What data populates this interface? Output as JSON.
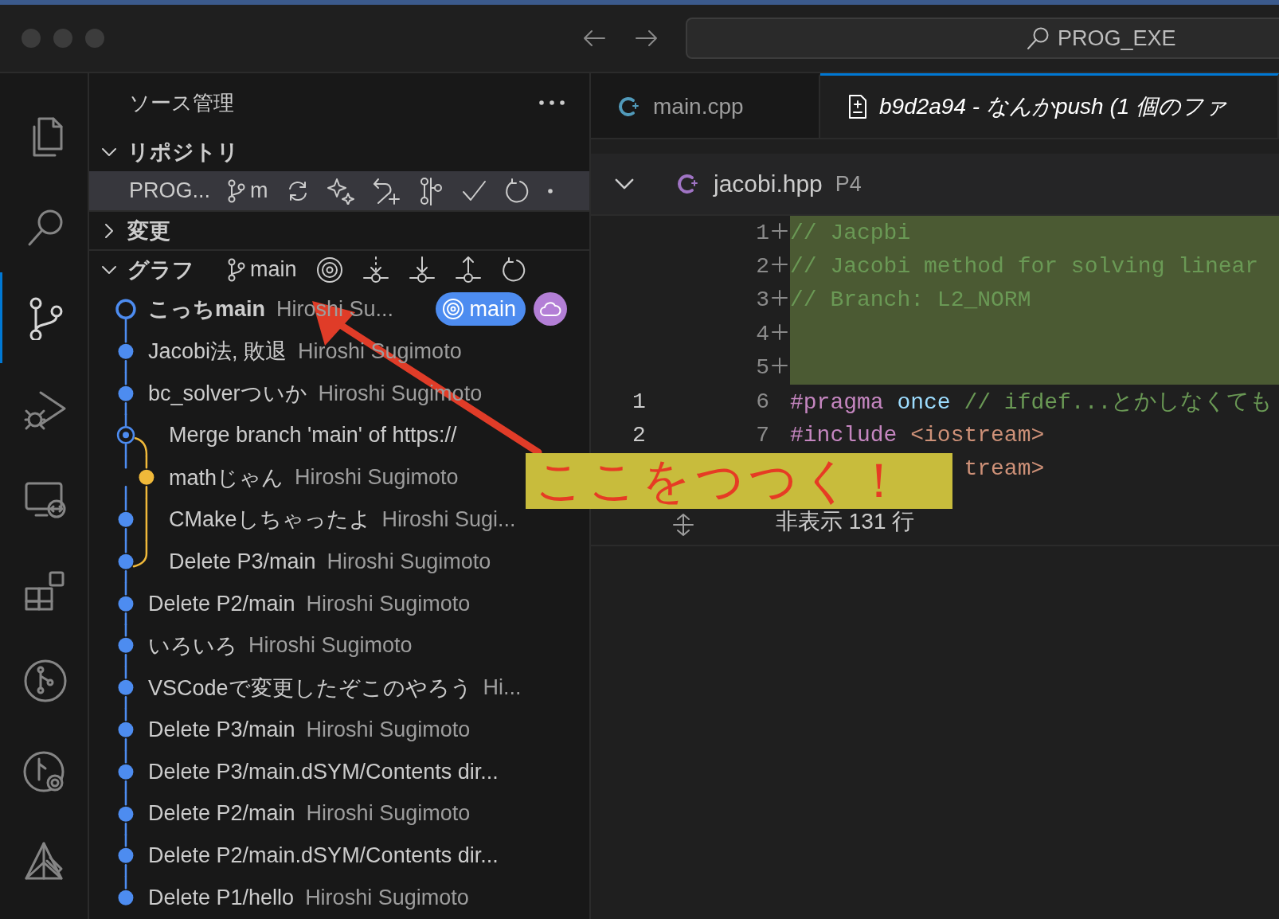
{
  "title_bar": {
    "search": "PROG_EXE"
  },
  "activity_bar": {
    "items": [
      {
        "kind": "files",
        "selected": false
      },
      {
        "kind": "search",
        "selected": false
      },
      {
        "kind": "source-control",
        "selected": true
      },
      {
        "kind": "run-debug",
        "selected": false
      },
      {
        "kind": "remote",
        "selected": false
      },
      {
        "kind": "extensions",
        "selected": false
      },
      {
        "kind": "git-graph",
        "selected": false
      },
      {
        "kind": "git-search",
        "selected": false
      },
      {
        "kind": "tools",
        "selected": false
      }
    ]
  },
  "scm": {
    "title": "ソース管理",
    "repositories": {
      "title": "リポジトリ",
      "expanded": true,
      "repo": {
        "name": "PROG...",
        "branch": "m"
      }
    },
    "changes": {
      "title": "変更",
      "expanded": false
    },
    "graph": {
      "title": "グラフ",
      "expanded": true,
      "branch": "main",
      "commits": [
        {
          "message": "こっちmain",
          "author": "Hiroshi Su...",
          "kind": "head",
          "side_line": false,
          "badges": [
            {
              "kind": "branch",
              "label": "main"
            },
            {
              "kind": "remote"
            }
          ]
        },
        {
          "message": "Jacobi法, 敗退",
          "author": "Hiroshi Sugimoto",
          "kind": "commit",
          "side_line": false
        },
        {
          "message": "bc_solverついか",
          "author": "Hiroshi Sugimoto",
          "kind": "commit",
          "side_line": false
        },
        {
          "message": "Merge branch 'main' of https://",
          "kind": "merge",
          "side_line": true
        },
        {
          "message": "mathじゃん",
          "author": "Hiroshi Sugimoto",
          "kind": "side-commit",
          "side_line": true
        },
        {
          "message": "CMakeしちゃったよ",
          "author": "Hiroshi Sugi...",
          "kind": "commit",
          "side_line": true
        },
        {
          "message": "Delete P3/main",
          "author": "Hiroshi Sugimoto",
          "kind": "commit",
          "side_line": true
        },
        {
          "message": "Delete P2/main",
          "author": "Hiroshi Sugimoto",
          "kind": "commit",
          "side_line": false
        },
        {
          "message": "いろいろ",
          "author": "Hiroshi Sugimoto",
          "kind": "commit",
          "side_line": false
        },
        {
          "message": "VSCodeで変更したぞこのやろう",
          "author": "Hi...",
          "kind": "commit",
          "side_line": false
        },
        {
          "message": "Delete P3/main",
          "author": "Hiroshi Sugimoto",
          "kind": "commit",
          "side_line": false
        },
        {
          "message": "Delete P3/main.dSYM/Contents dir...",
          "kind": "commit",
          "side_line": false
        },
        {
          "message": "Delete P2/main",
          "author": "Hiroshi Sugimoto",
          "kind": "commit",
          "side_line": false
        },
        {
          "message": "Delete P2/main.dSYM/Contents dir...",
          "kind": "commit",
          "side_line": false
        },
        {
          "message": "Delete P1/hello",
          "author": "Hiroshi Sugimoto",
          "kind": "commit",
          "side_line": false
        }
      ]
    }
  },
  "editor": {
    "tabs": [
      {
        "label": "main.cpp",
        "kind": "cpp",
        "selected": false
      },
      {
        "label": "b9d2a94 - なんかpush (1 個のファ",
        "kind": "diff",
        "selected": true
      }
    ],
    "diff": {
      "file": "jacobi.hpp",
      "folder": "P4",
      "expanded": true,
      "lines": [
        {
          "new": "1",
          "added": true,
          "covered": false,
          "tokens": [
            {
              "kind": "comment",
              "text": "// Jacpbi"
            }
          ]
        },
        {
          "new": "2",
          "added": true,
          "covered": false,
          "tokens": [
            {
              "kind": "comment",
              "text": "// Jacobi method for solving linear"
            }
          ]
        },
        {
          "new": "3",
          "added": true,
          "covered": false,
          "tokens": [
            {
              "kind": "comment",
              "text": "// Branch: L2_NORM"
            }
          ]
        },
        {
          "new": "4",
          "added": true,
          "covered": false
        },
        {
          "new": "5",
          "added": true,
          "covered": false
        },
        {
          "old": "1",
          "new": "6",
          "added": false,
          "covered": false,
          "tokens": [
            {
              "kind": "keyword",
              "text": "#pragma"
            },
            {
              "kind": "identifier",
              "text": " once"
            },
            {
              "kind": "comment",
              "text": " // ifdef...とかしなくても"
            }
          ]
        },
        {
          "old": "2",
          "new": "7",
          "added": false,
          "covered": false,
          "tokens": [
            {
              "kind": "keyword",
              "text": "#include"
            },
            {
              "kind": "string",
              "text": " <iostream>"
            }
          ]
        },
        {
          "added": false,
          "covered": true,
          "tokens": [
            {
              "kind": "string",
              "text": "tream>"
            }
          ]
        }
      ],
      "hidden": "非表示 131 行"
    }
  },
  "annotation": {
    "text": "ここをつつく！"
  }
}
